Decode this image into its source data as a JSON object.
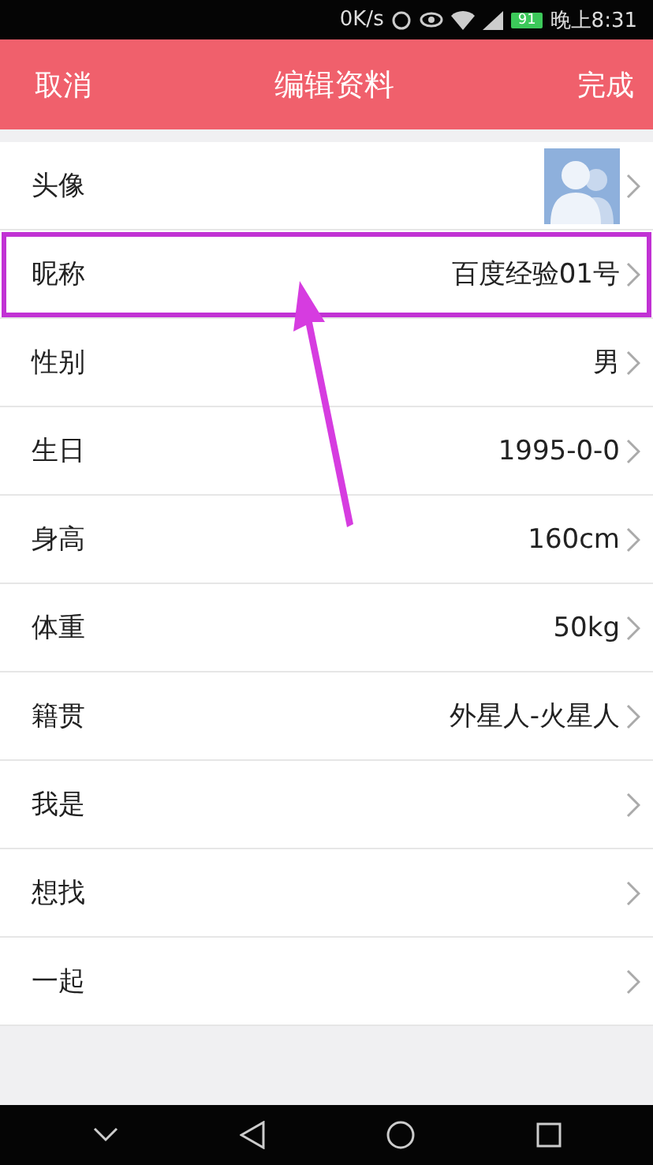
{
  "status_bar": {
    "speed": "0K/s",
    "battery": "91",
    "time": "晚上8:31"
  },
  "header": {
    "cancel": "取消",
    "title": "编辑资料",
    "done": "完成"
  },
  "rows": [
    {
      "label": "头像",
      "kind": "avatar",
      "highlighted": false
    },
    {
      "label": "昵称",
      "kind": "text",
      "value": "百度经验01号",
      "highlighted": true
    },
    {
      "label": "性别",
      "kind": "text",
      "value": "男",
      "highlighted": false
    },
    {
      "label": "生日",
      "kind": "text",
      "value": "1995-0-0",
      "highlighted": false
    },
    {
      "label": "身高",
      "kind": "text",
      "value": "160cm",
      "highlighted": false
    },
    {
      "label": "体重",
      "kind": "text",
      "value": "50kg",
      "highlighted": false
    },
    {
      "label": "籍贯",
      "kind": "text",
      "value": "外星人-火星人",
      "highlighted": false
    },
    {
      "label": "我是",
      "kind": "text",
      "highlighted": false
    },
    {
      "label": "想找",
      "kind": "text",
      "highlighted": false
    },
    {
      "label": "一起",
      "kind": "text",
      "highlighted": false
    }
  ]
}
